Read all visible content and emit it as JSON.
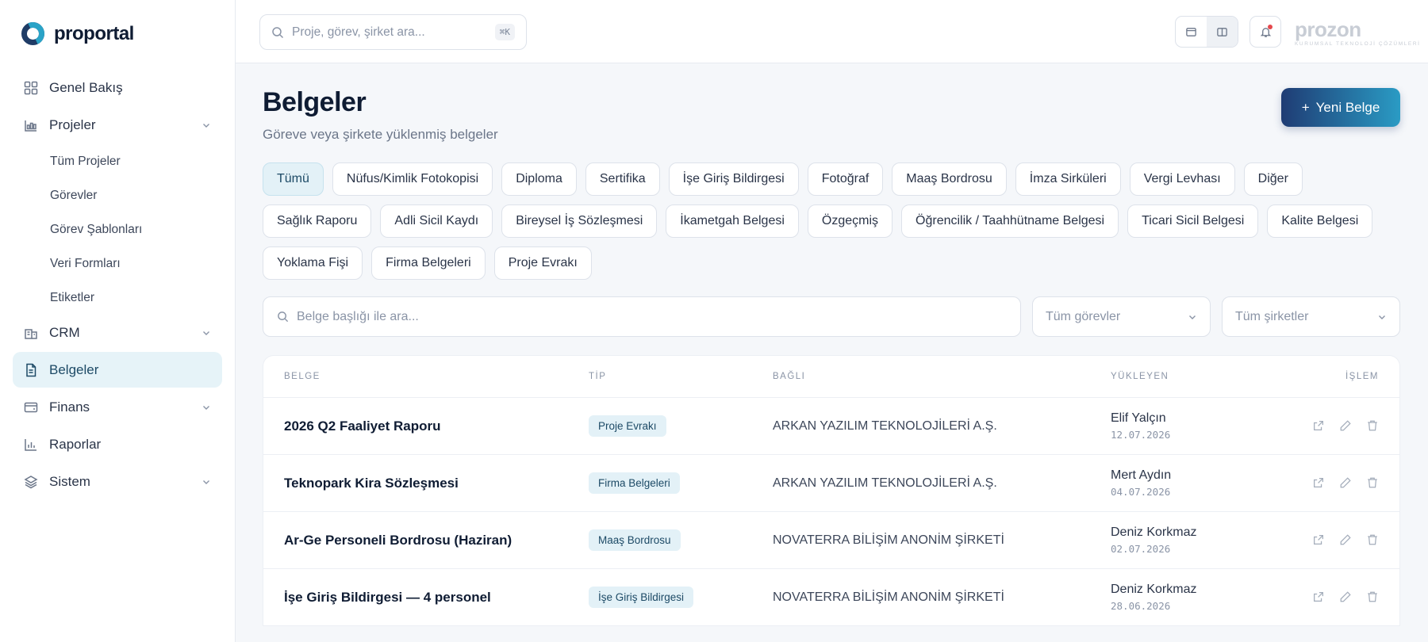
{
  "app": {
    "name": "proportal"
  },
  "sidebar": {
    "items": [
      {
        "label": "Genel Bakış",
        "icon": "grid-icon"
      },
      {
        "label": "Projeler",
        "icon": "chart-box-icon",
        "expanded": true,
        "children": [
          {
            "label": "Tüm Projeler"
          },
          {
            "label": "Görevler"
          },
          {
            "label": "Görev Şablonları"
          },
          {
            "label": "Veri Formları"
          },
          {
            "label": "Etiketler"
          }
        ]
      },
      {
        "label": "CRM",
        "icon": "building-icon"
      },
      {
        "label": "Belgeler",
        "icon": "document-icon",
        "active": true
      },
      {
        "label": "Finans",
        "icon": "wallet-icon"
      },
      {
        "label": "Raporlar",
        "icon": "bar-chart-icon"
      },
      {
        "label": "Sistem",
        "icon": "layers-icon"
      }
    ]
  },
  "topbar": {
    "search_placeholder": "Proje, görev, şirket ara...",
    "shortcut": "⌘K",
    "brand_name": "prozon",
    "brand_tagline": "KURUMSAL TEKNOLOJİ ÇÖZÜMLERİ"
  },
  "page": {
    "title": "Belgeler",
    "subtitle": "Göreve veya şirkete yüklenmiş belgeler",
    "new_button": "Yeni Belge",
    "new_button_icon": "+"
  },
  "categories": [
    "Tümü",
    "Nüfus/Kimlik Fotokopisi",
    "Diploma",
    "Sertifika",
    "İşe Giriş Bildirgesi",
    "Fotoğraf",
    "Maaş Bordrosu",
    "İmza Sirküleri",
    "Vergi Levhası",
    "Diğer",
    "Sağlık Raporu",
    "Adli Sicil Kaydı",
    "Bireysel İş Sözleşmesi",
    "İkametgah Belgesi",
    "Özgeçmiş",
    "Öğrencilik / Taahhütname Belgesi",
    "Ticari Sicil Belgesi",
    "Kalite Belgesi",
    "Yoklama Fişi",
    "Firma Belgeleri",
    "Proje Evrakı"
  ],
  "active_category": "Tümü",
  "filters": {
    "search_placeholder": "Belge başlığı ile ara...",
    "task_select": "Tüm görevler",
    "company_select": "Tüm şirketler"
  },
  "table": {
    "headers": [
      "BELGE",
      "TİP",
      "BAĞLI",
      "YÜKLEYEN",
      "İŞLEM"
    ],
    "rows": [
      {
        "title": "2026 Q2 Faaliyet Raporu",
        "type": "Proje Evrakı",
        "linked": "ARKAN YAZILIM TEKNOLOJİLERİ A.Ş.",
        "uploader": "Elif Yalçın",
        "date": "12.07.2026"
      },
      {
        "title": "Teknopark Kira Sözleşmesi",
        "type": "Firma Belgeleri",
        "linked": "ARKAN YAZILIM TEKNOLOJİLERİ A.Ş.",
        "uploader": "Mert Aydın",
        "date": "04.07.2026"
      },
      {
        "title": "Ar-Ge Personeli Bordrosu (Haziran)",
        "type": "Maaş Bordrosu",
        "linked": "NOVATERRA BİLİŞİM ANONİM ŞİRKETİ",
        "uploader": "Deniz Korkmaz",
        "date": "02.07.2026"
      },
      {
        "title": "İşe Giriş Bildirgesi — 4 personel",
        "type": "İşe Giriş Bildirgesi",
        "linked": "NOVATERRA BİLİŞİM ANONİM ŞİRKETİ",
        "uploader": "Deniz Korkmaz",
        "date": "28.06.2026"
      }
    ]
  },
  "colors": {
    "accent": "#1f3c74",
    "accent_end": "#2a9bc4",
    "active_bg": "#e3f1f7"
  }
}
